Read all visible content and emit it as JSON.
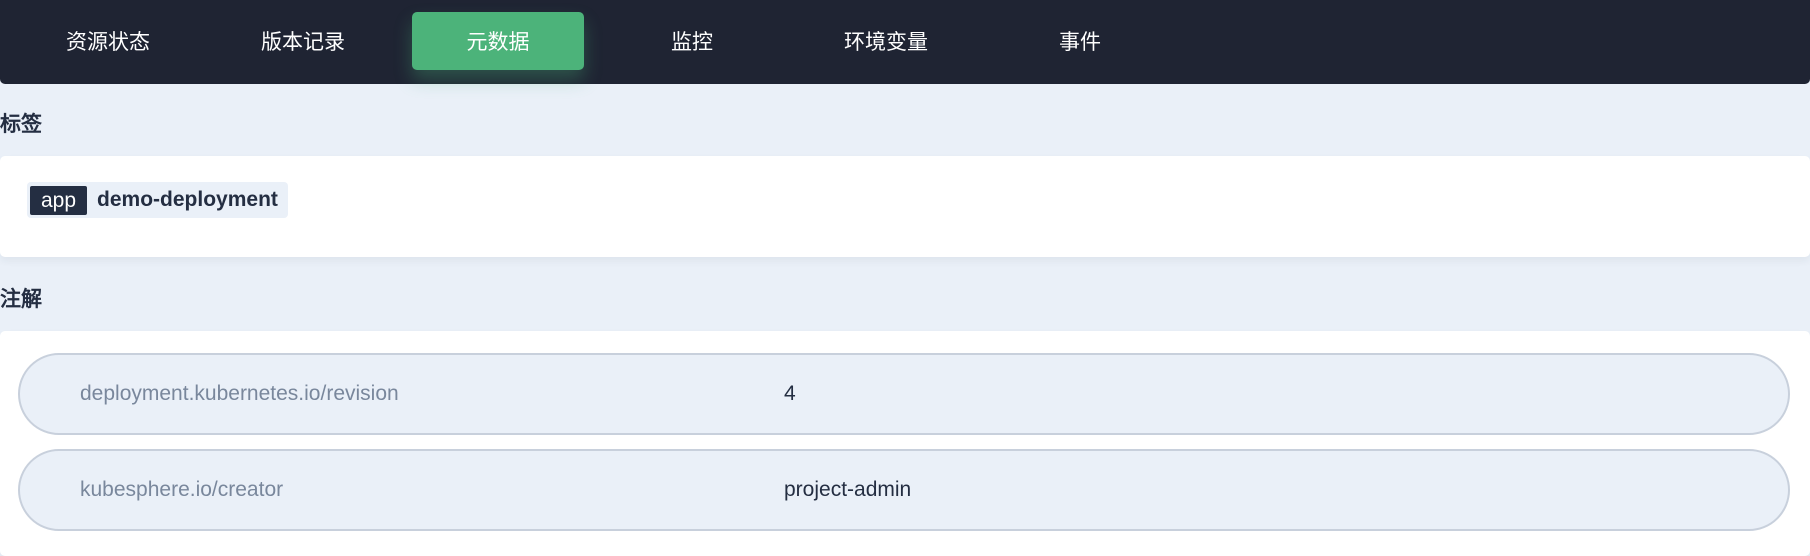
{
  "tabs": [
    {
      "label": "资源状态",
      "active": false
    },
    {
      "label": "版本记录",
      "active": false
    },
    {
      "label": "元数据",
      "active": true
    },
    {
      "label": "监控",
      "active": false
    },
    {
      "label": "环境变量",
      "active": false
    },
    {
      "label": "事件",
      "active": false
    }
  ],
  "labels_section": {
    "title": "标签",
    "items": [
      {
        "key": "app",
        "value": "demo-deployment"
      }
    ]
  },
  "annotations_section": {
    "title": "注解",
    "items": [
      {
        "key": "deployment.kubernetes.io/revision",
        "value": "4"
      },
      {
        "key": "kubesphere.io/creator",
        "value": "project-admin"
      }
    ]
  },
  "colors": {
    "tabbar_bg": "#1f2433",
    "active_tab": "#4cb37a",
    "page_bg": "#eaf0f8",
    "text_dark": "#242e42",
    "text_muted": "#79879c"
  }
}
